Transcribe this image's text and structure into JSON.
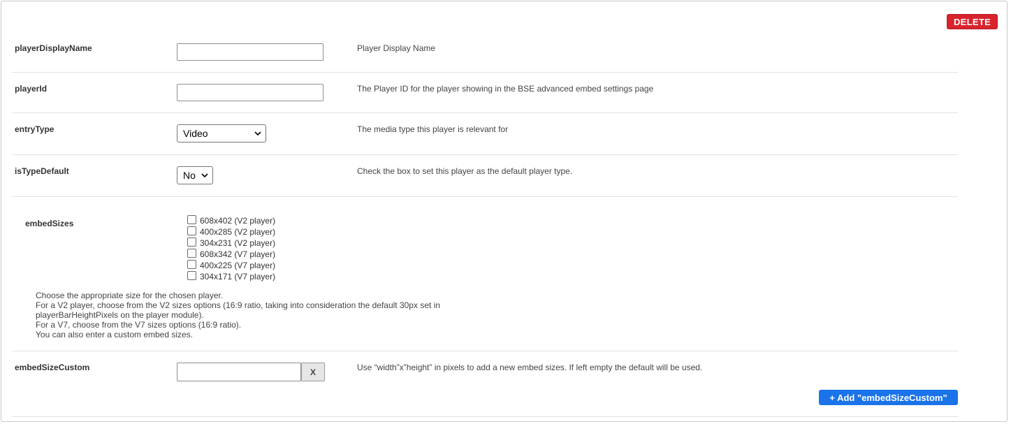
{
  "delete_label": "DELETE",
  "rows": {
    "playerDisplayName": {
      "label": "playerDisplayName",
      "value": "",
      "description": "Player Display Name"
    },
    "playerId": {
      "label": "playerId",
      "value": "",
      "description": "The Player ID for the player showing in the BSE advanced embed settings page"
    },
    "entryType": {
      "label": "entryType",
      "selected": "Video",
      "description": "The media type this player is relevant for"
    },
    "isTypeDefault": {
      "label": "isTypeDefault",
      "selected": "No",
      "description": "Check the box to set this player as the default player type."
    },
    "embedSizes": {
      "label": "embedSizes",
      "options": [
        {
          "label": "608x402 (V2 player)",
          "checked": false
        },
        {
          "label": "400x285 (V2 player)",
          "checked": false
        },
        {
          "label": "304x231 (V2 player)",
          "checked": false
        },
        {
          "label": "608x342 (V7 player)",
          "checked": false
        },
        {
          "label": "400x225 (V7 player)",
          "checked": false
        },
        {
          "label": "304x171 (V7 player)",
          "checked": false
        }
      ],
      "help": [
        "Choose the appropriate size for the chosen player.",
        "For a V2 player, choose from the V2 sizes options (16:9 ratio, taking into consideration the default 30px set in",
        "playerBarHeightPixels on the player module).",
        "For a V7, choose from the V7 sizes options (16:9 ratio).",
        "You can also enter a custom embed sizes."
      ]
    },
    "embedSizeCustom": {
      "label": "embedSizeCustom",
      "value": "",
      "clear_label": "X",
      "description": "Use “width”x”height” in pixels to add a new embed sizes. If left empty the default will be used.",
      "add_label": "+ Add \"embedSizeCustom\""
    }
  }
}
